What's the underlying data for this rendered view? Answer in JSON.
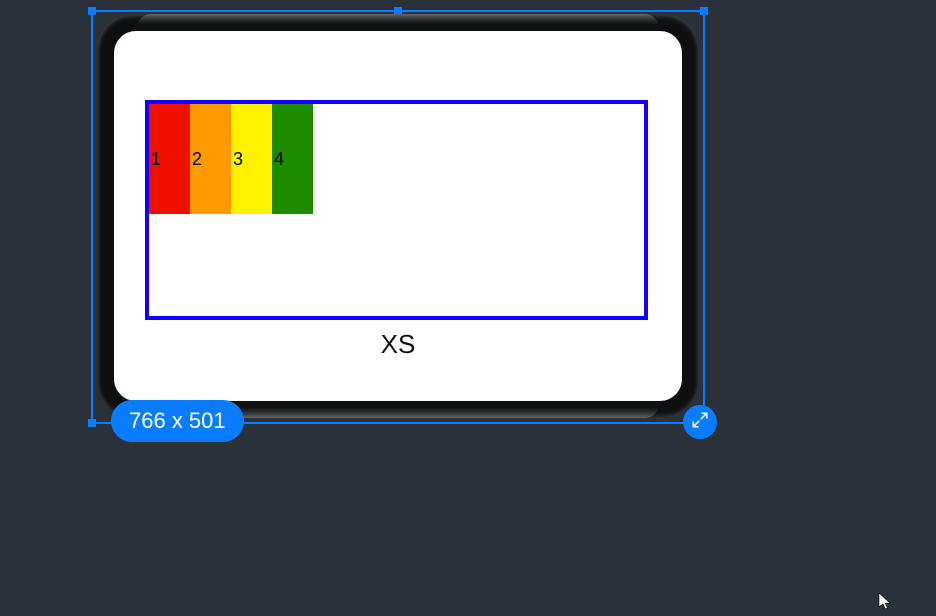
{
  "selection": {
    "dimensions_label": "766 x 501",
    "expand_icon": "expand-diagonal-icon"
  },
  "preview": {
    "box": {
      "border_color": "#1200ff",
      "items": [
        {
          "label": "1",
          "color": "#ef1000"
        },
        {
          "label": "2",
          "color": "#ff9900"
        },
        {
          "label": "3",
          "color": "#fff200"
        },
        {
          "label": "4",
          "color": "#1e8c00"
        }
      ]
    },
    "breakpoint_label": "XS"
  },
  "colors": {
    "accent": "#0a7cff",
    "canvas_bg": "#2b3139"
  }
}
